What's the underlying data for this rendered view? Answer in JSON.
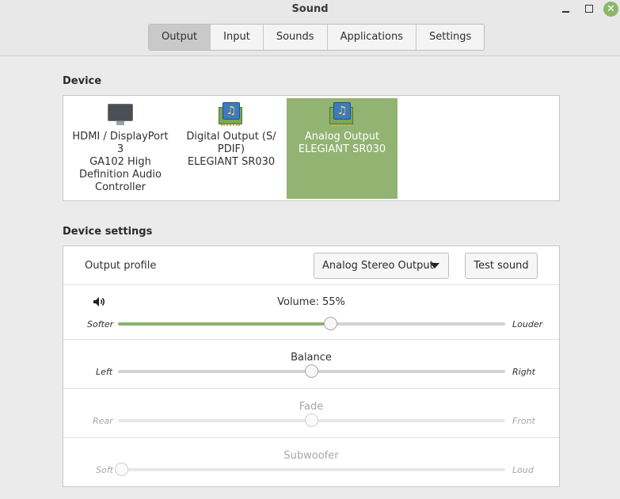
{
  "window": {
    "title": "Sound",
    "close_glyph": "✕"
  },
  "tabs": [
    {
      "label": "Output",
      "active": true
    },
    {
      "label": "Input",
      "active": false
    },
    {
      "label": "Sounds",
      "active": false
    },
    {
      "label": "Applications",
      "active": false
    },
    {
      "label": "Settings",
      "active": false
    }
  ],
  "device_section": {
    "label": "Device",
    "devices": [
      {
        "lines": [
          "HDMI / DisplayPort",
          "3",
          "GA102 High",
          "Definition Audio",
          "Controller"
        ],
        "icon": "monitor-icon",
        "selected": false
      },
      {
        "lines": [
          "Digital Output (S/",
          "PDIF)",
          "ELEGIANT SR030"
        ],
        "icon": "sound-card-icon",
        "selected": false
      },
      {
        "lines": [
          "Analog Output",
          "ELEGIANT SR030"
        ],
        "icon": "sound-card-icon",
        "selected": true
      }
    ]
  },
  "settings_section": {
    "label": "Device settings",
    "output_profile_label": "Output profile",
    "output_profile_value": "Analog Stereo Output",
    "test_sound_label": "Test sound",
    "volume": {
      "title": "Volume: 55%",
      "left": "Softer",
      "right": "Louder",
      "value_pct": 55
    },
    "balance": {
      "title": "Balance",
      "left": "Left",
      "right": "Right",
      "value_pct": 50
    },
    "fade": {
      "title": "Fade",
      "left": "Rear",
      "right": "Front",
      "value_pct": 50
    },
    "subwoofer": {
      "title": "Subwoofer",
      "left": "Soft",
      "right": "Loud",
      "value_pct": 0
    }
  },
  "colors": {
    "accent": "#8db16b",
    "selected_device_bg": "#92b372"
  }
}
